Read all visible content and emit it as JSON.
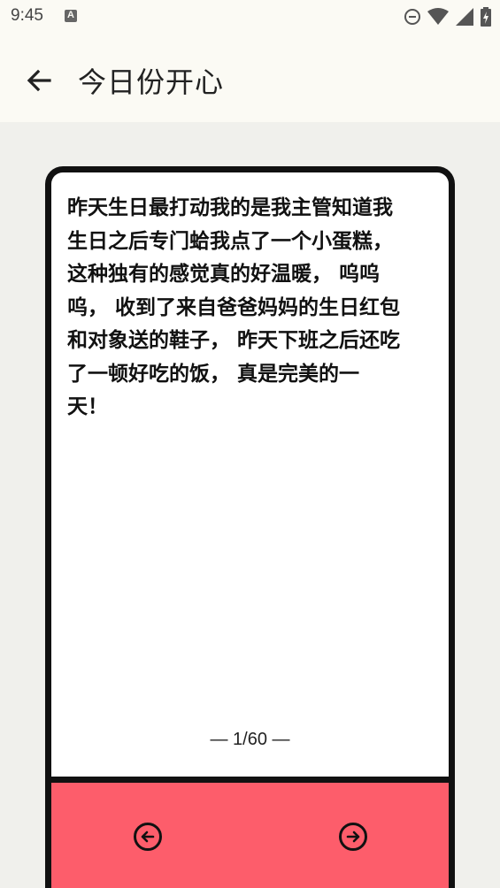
{
  "status_bar": {
    "time": "9:45",
    "icons": [
      "keyboard-indicator-icon",
      "do-not-disturb-icon",
      "wifi-icon",
      "cellular-signal-icon",
      "battery-icon"
    ]
  },
  "app_bar": {
    "back_icon": "arrow-left-icon",
    "title": "今日份开心"
  },
  "card": {
    "text": "昨天生日最打动我的是我主管知道我\n生日之后专门蛤我点了一个小蛋糕，\n这种独有的感觉真的好温暖， 呜呜\n呜， 收到了来自爸爸妈妈的生日红包\n和对象送的鞋子， 昨天下班之后还吃\n了一顿好吃的饭， 真是完美的一\n天！",
    "page_counter": "— 1/60 —",
    "footer_color": "#fd5d6b",
    "prev_icon": "arrow-left-circle-icon",
    "next_icon": "arrow-right-circle-icon"
  },
  "colors": {
    "background": "#f0f0ec",
    "app_bar": "#fbfaf4",
    "card_border": "#111111",
    "card_footer": "#fd5d6b"
  }
}
